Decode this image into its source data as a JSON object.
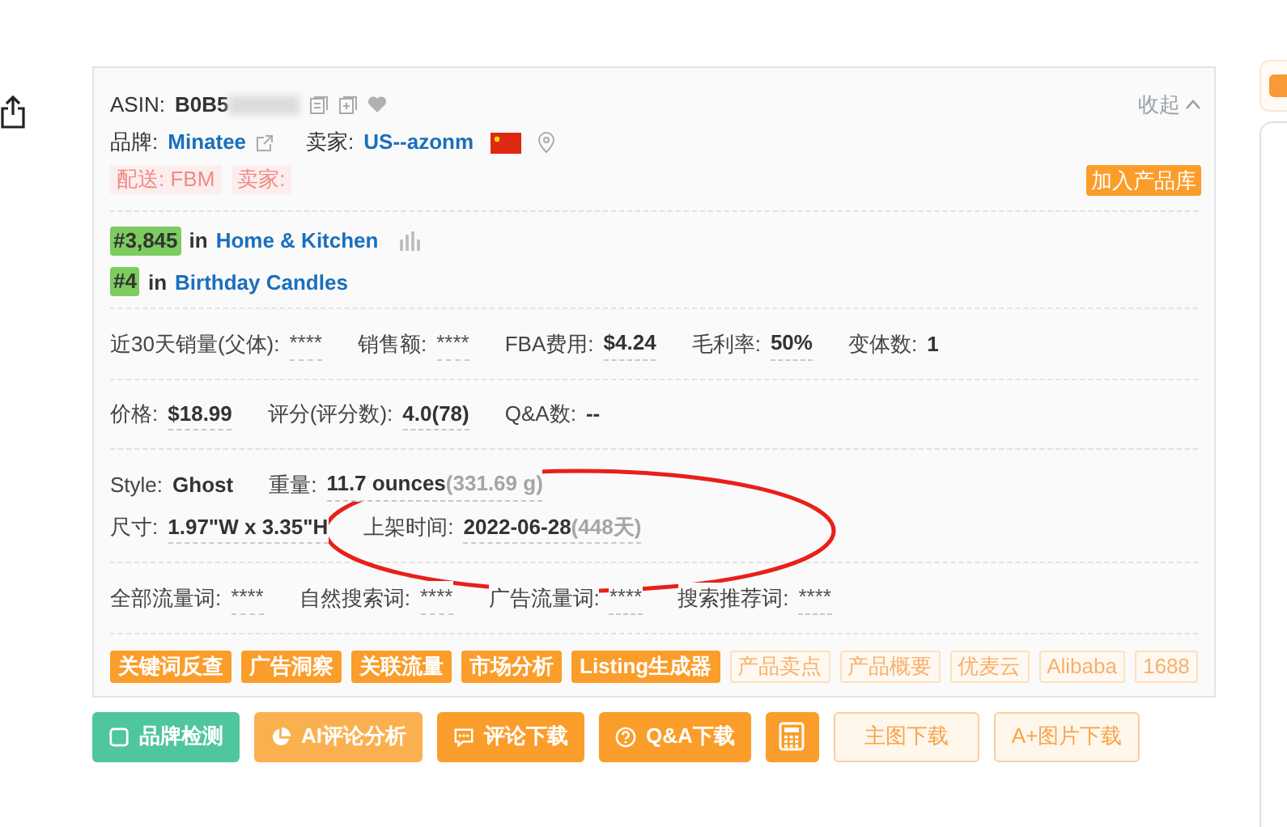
{
  "header": {
    "asin_label": "ASIN:",
    "asin": "B0B5",
    "collapse": "收起"
  },
  "brand": {
    "label": "品牌:",
    "value": "Minatee",
    "seller_label": "卖家:",
    "seller": "US--azonm"
  },
  "tags": [
    {
      "text": "配送: FBM"
    },
    {
      "text": "卖家:"
    }
  ],
  "add_button": "加入产品库",
  "ranks": [
    {
      "rank": "#3,845",
      "in": "in",
      "category": "Home & Kitchen"
    },
    {
      "rank": "#4",
      "in": "in",
      "category": "Birthday Candles"
    }
  ],
  "stat_groups": [
    [
      [
        {
          "label": "近30天销量(父体):",
          "value": "****",
          "kind": "hidden"
        },
        {
          "label": "销售额:",
          "value": "****",
          "kind": "hidden"
        },
        {
          "label": "FBA费用:",
          "value": "$4.24",
          "kind": "value"
        },
        {
          "label": "毛利率:",
          "value": "50%",
          "kind": "value"
        },
        {
          "label": "变体数:",
          "value": "1",
          "kind": "plain"
        }
      ]
    ],
    [
      [
        {
          "label": "价格:",
          "value": "$18.99",
          "kind": "value"
        },
        {
          "label": "评分(评分数):",
          "value": "4.0(78)",
          "kind": "value"
        },
        {
          "label": "Q&A数:",
          "value": "--",
          "kind": "plain"
        }
      ]
    ],
    [
      [
        {
          "label": "Style:",
          "value": "Ghost",
          "kind": "plain"
        },
        {
          "label": "重量:",
          "value": "11.7 ounces",
          "extra": "(331.69 g)",
          "kind": "value"
        }
      ],
      [
        {
          "label": "尺寸:",
          "value": "1.97\"W x 3.35\"H",
          "kind": "value"
        },
        {
          "label": "上架时间:",
          "value": "2022-06-28",
          "extra": "(448天)",
          "kind": "value"
        }
      ]
    ],
    [
      [
        {
          "label": "全部流量词:",
          "value": "****",
          "kind": "hidden"
        },
        {
          "label": "自然搜索词:",
          "value": "****",
          "kind": "hidden"
        },
        {
          "label": "广告流量词:",
          "value": "****",
          "kind": "hidden"
        },
        {
          "label": "搜索推荐词:",
          "value": "****",
          "kind": "hidden"
        }
      ]
    ]
  ],
  "tools": [
    {
      "text": "关键词反查",
      "kind": "solid"
    },
    {
      "text": "广告洞察",
      "kind": "solid"
    },
    {
      "text": "关联流量",
      "kind": "solid"
    },
    {
      "text": "市场分析",
      "kind": "solid"
    },
    {
      "text": "Listing生成器",
      "kind": "solid"
    },
    {
      "text": "产品卖点",
      "kind": "outline"
    },
    {
      "text": "产品概要",
      "kind": "outline"
    },
    {
      "text": "优麦云",
      "kind": "outline"
    },
    {
      "text": "Alibaba",
      "kind": "outline"
    },
    {
      "text": "1688",
      "kind": "outline"
    }
  ],
  "actions": [
    {
      "text": "品牌检测",
      "kind": "green"
    },
    {
      "text": "AI评论分析",
      "kind": "light"
    },
    {
      "text": "评论下载",
      "kind": "orange"
    },
    {
      "text": "Q&A下载",
      "kind": "orange"
    },
    {
      "kind": "orange"
    },
    {
      "text": "主图下载",
      "kind": "outline"
    },
    {
      "text": "A+图片下载",
      "kind": "outline"
    }
  ]
}
